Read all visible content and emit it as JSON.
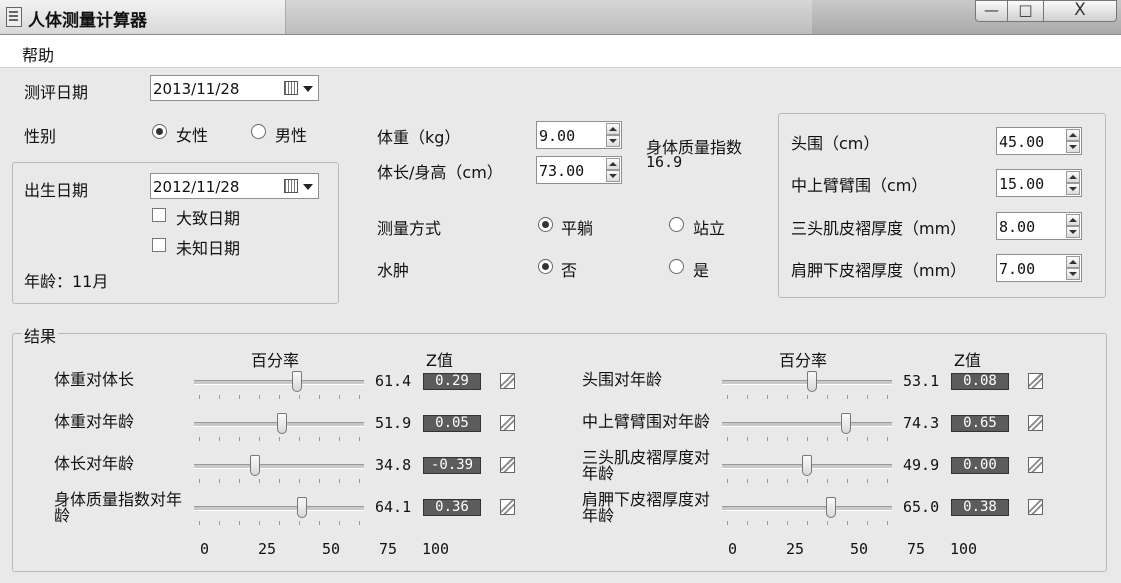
{
  "window": {
    "title": "人体测量计算器",
    "min": "—",
    "max": "□",
    "close": "X"
  },
  "menu": {
    "help": "帮助"
  },
  "assessment": {
    "label": "测评日期",
    "value": "2013/11/28"
  },
  "sex": {
    "label": "性别",
    "female": "女性",
    "male": "男性",
    "selected": "female"
  },
  "birth": {
    "label": "出生日期",
    "value": "2012/11/28",
    "approx": "大致日期",
    "unknown": "未知日期",
    "age": "年龄：11月"
  },
  "weight": {
    "label": "体重（kg）",
    "value": "9.00"
  },
  "length": {
    "label": "体长/身高（cm）",
    "value": "73.00"
  },
  "bmi": {
    "label": "身体质量指数",
    "value": "16.9"
  },
  "method": {
    "label": "测量方式",
    "supine": "平躺",
    "standing": "站立",
    "selected": "supine"
  },
  "edema": {
    "label": "水肿",
    "no": "否",
    "yes": "是",
    "selected": "no"
  },
  "head": {
    "label": "头围（cm）",
    "value": "45.00"
  },
  "muac": {
    "label": "中上臂臂围（cm）",
    "value": "15.00"
  },
  "tsf": {
    "label": "三头肌皮褶厚度（mm）",
    "value": "8.00"
  },
  "ssf": {
    "label": "肩胛下皮褶厚度（mm）",
    "value": "7.00"
  },
  "results": {
    "title": "结果",
    "col_percentile": "百分率",
    "col_z": "Z值",
    "scale": [
      "0",
      "25",
      "50",
      "75",
      "100"
    ],
    "left": [
      {
        "name": "体重对体长",
        "percentile": 61.4,
        "pct_text": "61.4",
        "z": "0.29"
      },
      {
        "name": "体重对年龄",
        "percentile": 51.9,
        "pct_text": "51.9",
        "z": "0.05"
      },
      {
        "name": "体长对年龄",
        "percentile": 34.8,
        "pct_text": "34.8",
        "z": "-0.39"
      },
      {
        "name": "身体质量指数对年\n龄",
        "percentile": 64.1,
        "pct_text": "64.1",
        "z": "0.36"
      }
    ],
    "right": [
      {
        "name": "头围对年龄",
        "percentile": 53.1,
        "pct_text": "53.1",
        "z": "0.08"
      },
      {
        "name": "中上臂臂围对年龄",
        "percentile": 74.3,
        "pct_text": "74.3",
        "z": "0.65"
      },
      {
        "name": "三头肌皮褶厚度对\n年龄",
        "percentile": 49.9,
        "pct_text": "49.9",
        "z": "0.00"
      },
      {
        "name": "肩胛下皮褶厚度对\n年龄",
        "percentile": 65.0,
        "pct_text": "65.0",
        "z": "0.38"
      }
    ]
  }
}
